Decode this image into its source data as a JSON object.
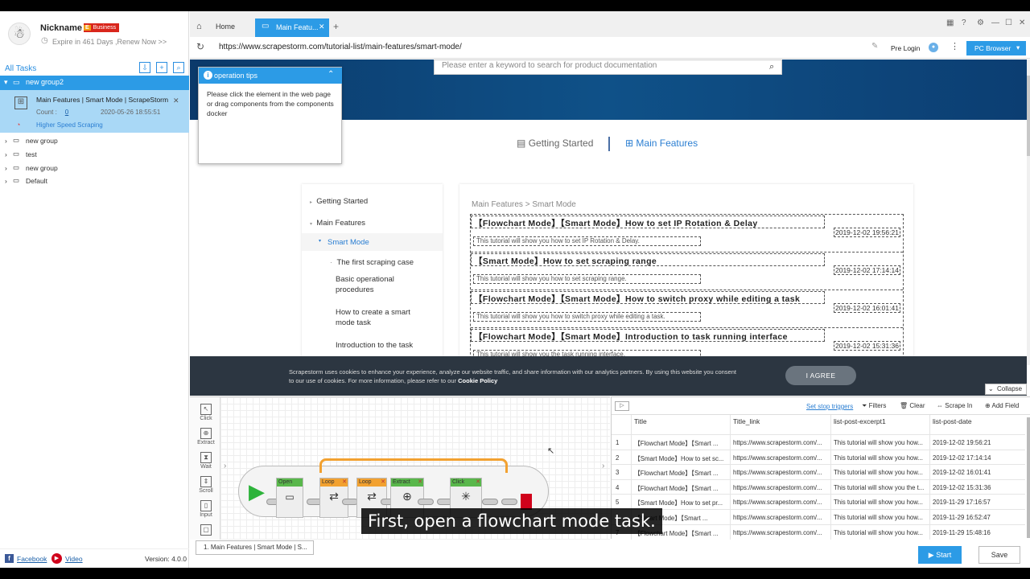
{
  "user": {
    "nickname": "Nickname",
    "badge_letter": "E",
    "badge": "Business",
    "expire": "Expire in 461 Days ,Renew Now >>"
  },
  "tasks": {
    "all_label": "All Tasks",
    "active_group": "new group2",
    "task_title": "Main Features | Smart Mode | ScrapeStorm...",
    "count_label": "Count :",
    "count_value": "0",
    "date": "2020-05-26 18:55:51",
    "speed_label": "Higher Speed Scraping",
    "groups": [
      "new group",
      "test",
      "new group",
      "Default"
    ]
  },
  "footer": {
    "facebook": "Facebook",
    "video": "Video",
    "version": "Version: 4.0.0"
  },
  "browser": {
    "home_tab": "Home",
    "active_tab": "Main Featu...",
    "url": "https://www.scrapestorm.com/tutorial-list/main-features/smart-mode/",
    "pre_login": "Pre Login",
    "pc_browser": "PC Browser"
  },
  "page": {
    "search_placeholder": "Please enter a keyword to search for product documentation",
    "nav": [
      "Getting Started",
      "Main Features"
    ],
    "sidebar": {
      "getting_started": "Getting Started",
      "main_features": "Main Features",
      "smart_mode": "Smart Mode",
      "items": [
        "The first scraping case",
        "Basic operational procedures",
        "How to create a smart mode task",
        "Introduction to the task"
      ]
    },
    "breadcrumb": "Main Features > Smart Mode",
    "articles": [
      {
        "title": "【Flowchart Mode】【Smart Mode】How to set IP Rotation & Delay",
        "sub": "This tutorial will show you how to set IP Rotation & Delay.",
        "date": "2019-12-02 19:56:21"
      },
      {
        "title": "【Smart Mode】How to set scraping range",
        "sub": "This tutorial will show you how to set scraping range.",
        "date": "2019-12-02 17:14:14"
      },
      {
        "title": "【Flowchart Mode】【Smart Mode】How to switch proxy while editing a task",
        "sub": "This tutorial will show you how to switch proxy while editing a task.",
        "date": "2019-12-02 16:01:41"
      },
      {
        "title": "【Flowchart Mode】【Smart Mode】Introduction to task running interface",
        "sub": "This tutorial will show you the task running interface.",
        "date": "2019-12-02 15:31:36"
      }
    ]
  },
  "tips": {
    "title": "operation tips",
    "text": "Please click the element in the web page or drag components from the components docker"
  },
  "cookie": {
    "text": "Scrapestorm uses cookies to enhance your experience, analyze our website traffic, and share information with our analytics partners. By using this website you consent to our use of cookies. For more information, please refer to our ",
    "policy": "Cookie Policy",
    "agree": "I AGREE"
  },
  "flow": {
    "collapse": "Collapse",
    "tools": [
      "Click",
      "Extract",
      "Wait",
      "Scroll",
      "Input"
    ],
    "blocks": [
      "Open",
      "Loop",
      "Loop",
      "Extract",
      "Click"
    ],
    "task_tab": "1. Main Features | Smart Mode | S..."
  },
  "data": {
    "stop_triggers": "Set stop triggers",
    "filters": "Filters",
    "clear": "Clear",
    "scrape_in": "Scrape In",
    "add_field": "Add Field",
    "columns": [
      "Title",
      "Title_link",
      "list-post-excerpt1",
      "list-post-date"
    ],
    "rows": [
      [
        "1",
        "【Flowchart Mode】【Smart ...",
        "https://www.scrapestorm.com/...",
        "This tutorial will show you how...",
        "2019-12-02 19:56:21"
      ],
      [
        "2",
        "【Smart Mode】How to set sc...",
        "https://www.scrapestorm.com/...",
        "This tutorial will show you how...",
        "2019-12-02 17:14:14"
      ],
      [
        "3",
        "【Flowchart Mode】【Smart ...",
        "https://www.scrapestorm.com/...",
        "This tutorial will show you how...",
        "2019-12-02 16:01:41"
      ],
      [
        "4",
        "【Flowchart Mode】【Smart ...",
        "https://www.scrapestorm.com/...",
        "This tutorial will show you the t...",
        "2019-12-02 15:31:36"
      ],
      [
        "5",
        "【Smart Mode】How to set pr...",
        "https://www.scrapestorm.com/...",
        "This tutorial will show you how...",
        "2019-11-29 17:16:57"
      ],
      [
        "6",
        "【Smart Mode】【Smart ...",
        "https://www.scrapestorm.com/...",
        "This tutorial will show you how...",
        "2019-11-29 16:52:47"
      ],
      [
        "7",
        "【Flowchart Mode】【Smart ...",
        "https://www.scrapestorm.com/...",
        "This tutorial will show you how...",
        "2019-11-29 15:48:16"
      ]
    ]
  },
  "actions": {
    "start": "Start",
    "save": "Save"
  },
  "caption": "First, open a flowchart mode task."
}
